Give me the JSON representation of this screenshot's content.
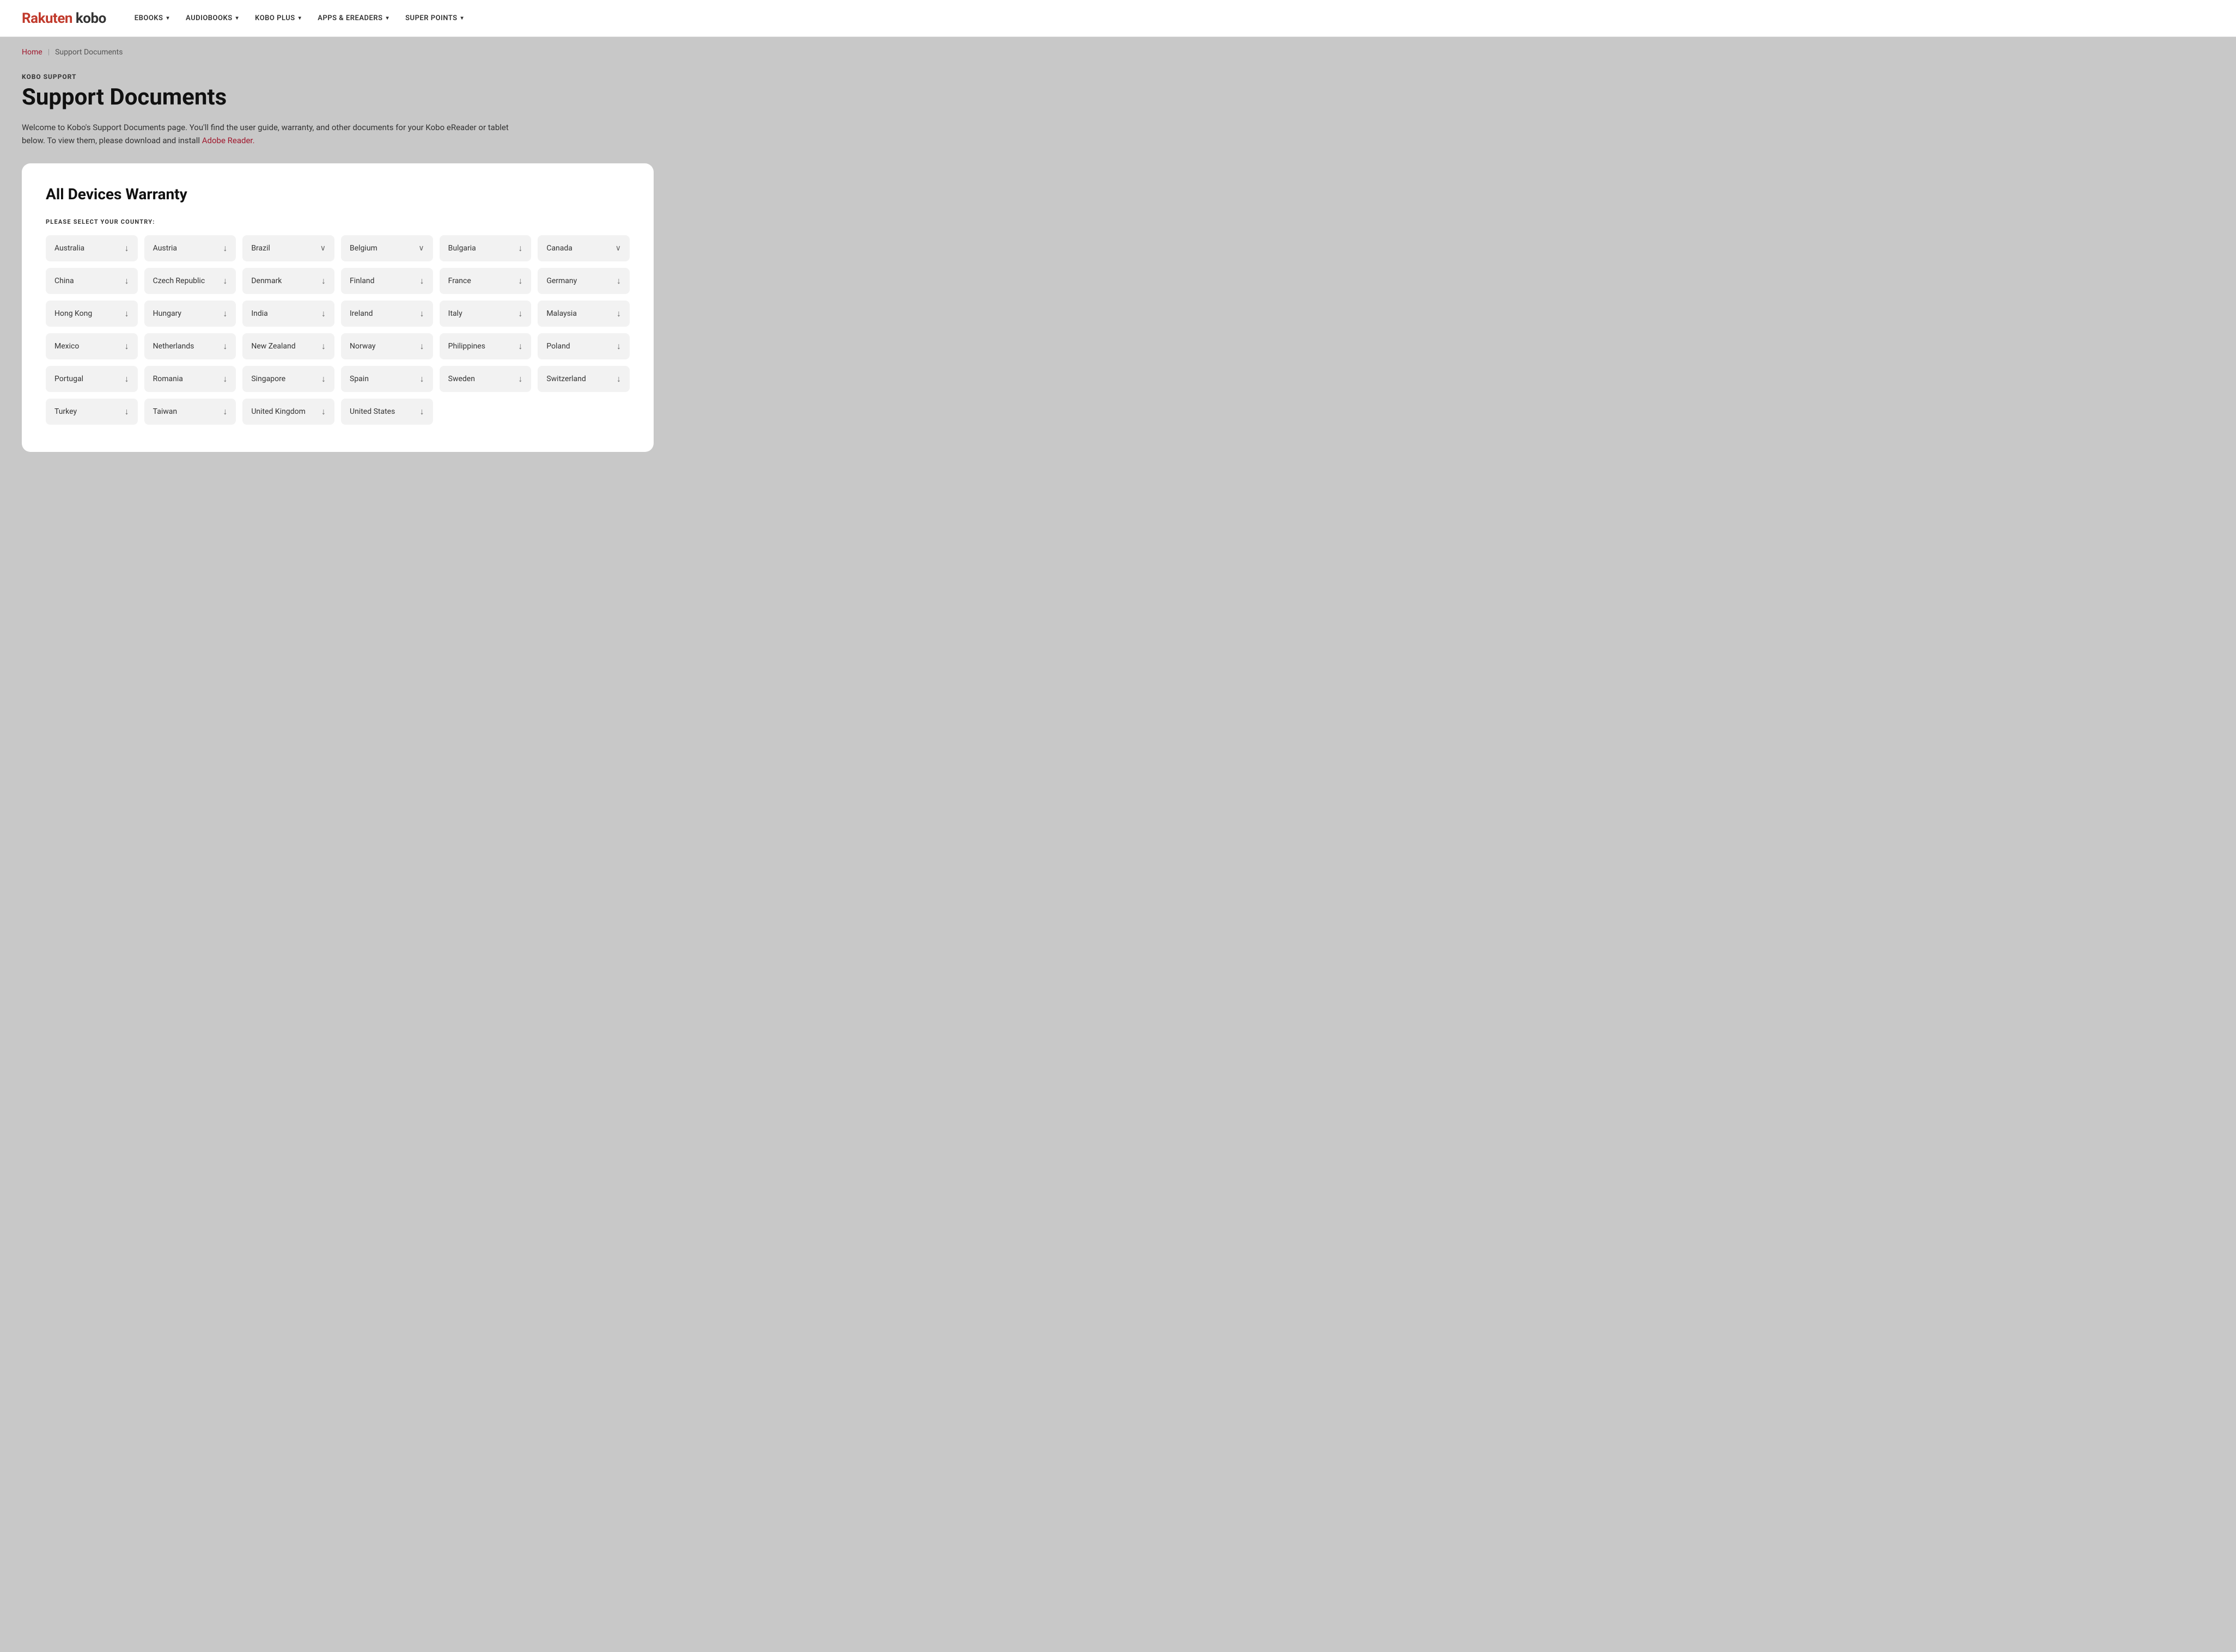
{
  "header": {
    "logo_first": "Rakuten",
    "logo_second": "kobo",
    "nav_items": [
      {
        "label": "eBOOKS",
        "has_dropdown": true
      },
      {
        "label": "AUDIOBOOKS",
        "has_dropdown": true
      },
      {
        "label": "KOBO PLUS",
        "has_dropdown": true
      },
      {
        "label": "APPS & eREADERS",
        "has_dropdown": true
      },
      {
        "label": "SUPER POINTS",
        "has_dropdown": true
      }
    ]
  },
  "breadcrumb": {
    "home_label": "Home",
    "separator": "|",
    "current": "Support Documents"
  },
  "page": {
    "section_label": "KOBO SUPPORT",
    "title": "Support Documents",
    "description_part1": "Welcome to Kobo's Support Documents page. You'll find the user guide, warranty, and other documents for your Kobo eReader or tablet below. To view them, please download and install ",
    "description_link": "Adobe Reader.",
    "description_part2": ""
  },
  "card": {
    "title": "All Devices Warranty",
    "country_label": "PLEASE SELECT YOUR COUNTRY:",
    "countries": [
      {
        "name": "Australia",
        "icon": "download",
        "type": "download"
      },
      {
        "name": "Austria",
        "icon": "download",
        "type": "download"
      },
      {
        "name": "Brazil",
        "icon": "chevron",
        "type": "dropdown"
      },
      {
        "name": "Belgium",
        "icon": "chevron",
        "type": "dropdown"
      },
      {
        "name": "Bulgaria",
        "icon": "download",
        "type": "download"
      },
      {
        "name": "Canada",
        "icon": "chevron",
        "type": "dropdown"
      },
      {
        "name": "China",
        "icon": "download",
        "type": "download"
      },
      {
        "name": "Czech Republic",
        "icon": "download",
        "type": "download"
      },
      {
        "name": "Denmark",
        "icon": "download",
        "type": "download"
      },
      {
        "name": "Finland",
        "icon": "download",
        "type": "download"
      },
      {
        "name": "France",
        "icon": "download",
        "type": "download"
      },
      {
        "name": "Germany",
        "icon": "download",
        "type": "download"
      },
      {
        "name": "Hong Kong",
        "icon": "download",
        "type": "download"
      },
      {
        "name": "Hungary",
        "icon": "download",
        "type": "download"
      },
      {
        "name": "India",
        "icon": "download",
        "type": "download"
      },
      {
        "name": "Ireland",
        "icon": "download",
        "type": "download"
      },
      {
        "name": "Italy",
        "icon": "download",
        "type": "download"
      },
      {
        "name": "Malaysia",
        "icon": "download",
        "type": "download"
      },
      {
        "name": "Mexico",
        "icon": "download",
        "type": "download"
      },
      {
        "name": "Netherlands",
        "icon": "download",
        "type": "download"
      },
      {
        "name": "New Zealand",
        "icon": "download",
        "type": "download"
      },
      {
        "name": "Norway",
        "icon": "download",
        "type": "download"
      },
      {
        "name": "Philippines",
        "icon": "download",
        "type": "download"
      },
      {
        "name": "Poland",
        "icon": "download",
        "type": "download"
      },
      {
        "name": "Portugal",
        "icon": "download",
        "type": "download"
      },
      {
        "name": "Romania",
        "icon": "download",
        "type": "download"
      },
      {
        "name": "Singapore",
        "icon": "download",
        "type": "download"
      },
      {
        "name": "Spain",
        "icon": "download",
        "type": "download"
      },
      {
        "name": "Sweden",
        "icon": "download",
        "type": "download"
      },
      {
        "name": "Switzerland",
        "icon": "download",
        "type": "download"
      },
      {
        "name": "Turkey",
        "icon": "download",
        "type": "download"
      },
      {
        "name": "Taiwan",
        "icon": "download",
        "type": "download"
      },
      {
        "name": "United Kingdom",
        "icon": "download",
        "type": "download"
      },
      {
        "name": "United States",
        "icon": "download",
        "type": "download"
      }
    ]
  }
}
